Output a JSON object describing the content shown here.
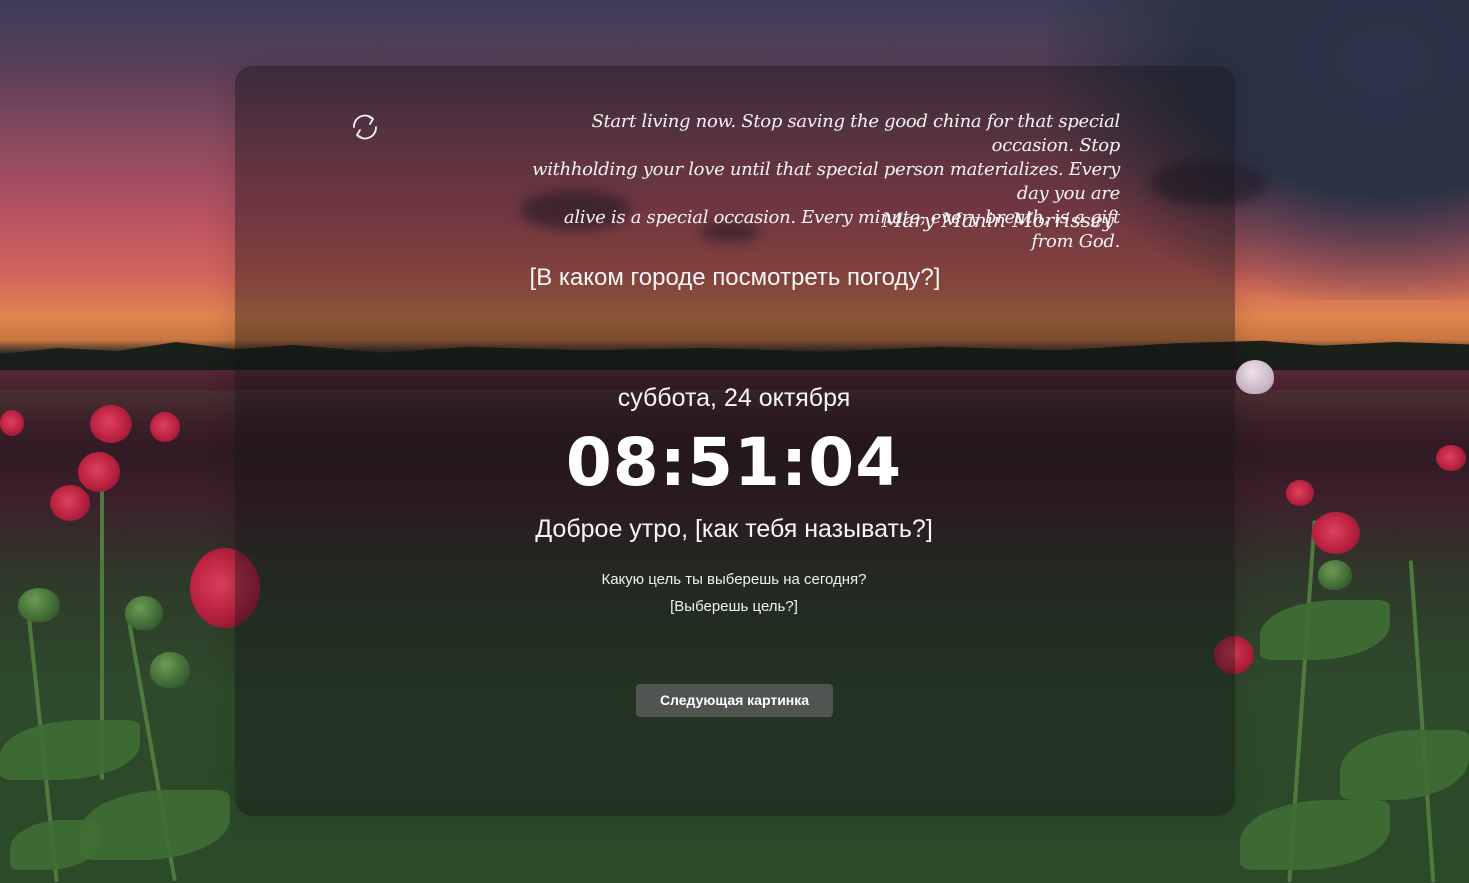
{
  "quote": {
    "lines": [
      "Start living now. Stop saving the good china for that special occasion. Stop",
      "withholding your love until that special person materializes. Every day you are",
      "alive is a special occasion. Every minute, every breath, is a gift from God."
    ],
    "author": "Mary Manin Morrissey"
  },
  "weather": {
    "city_prompt": "[В каком городе посмотреть погоду?]"
  },
  "clock": {
    "date": "суббота, 24 октября",
    "time": "08:51:04"
  },
  "greeting": {
    "text": "Доброе утро, ",
    "name_prompt": "[как тебя называть?]"
  },
  "focus": {
    "question": "Какую цель ты выберешь на сегодня?",
    "input_prompt": "[Выберешь цель?]"
  },
  "controls": {
    "refresh_icon": "refresh-icon",
    "next_image_label": "Следующая картинка"
  },
  "colors": {
    "panel_overlay": "#141416",
    "button_bg": "#5f5f5f",
    "text": "#ffffff"
  }
}
